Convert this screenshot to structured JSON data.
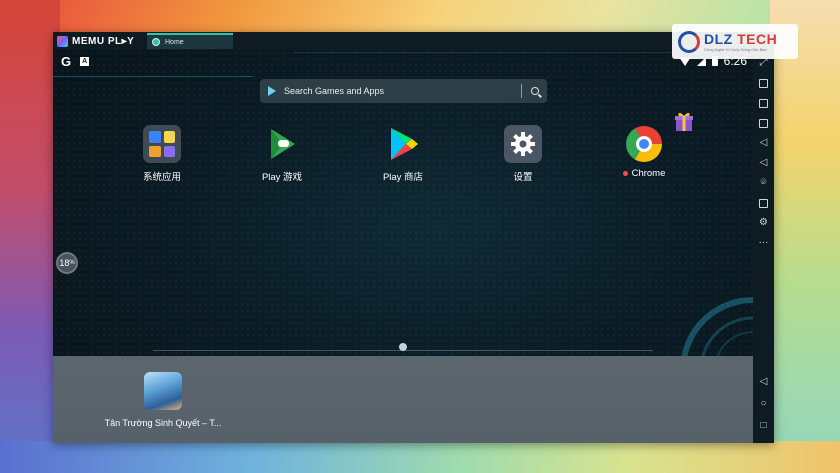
{
  "emulator": {
    "brand": "MEMU PL▸Y",
    "tab_label": "Home"
  },
  "status_bar": {
    "google_letter": "G",
    "a_letter": "A",
    "time": "6:26"
  },
  "search": {
    "placeholder": "Search Games and Apps"
  },
  "apps": [
    {
      "label": "系统应用",
      "icon": "system-apps-folder-icon"
    },
    {
      "label": "Play 游戏",
      "icon": "play-games-icon"
    },
    {
      "label": "Play 商店",
      "icon": "play-store-icon"
    },
    {
      "label": "设置",
      "icon": "settings-gear-icon"
    },
    {
      "label": "Chrome",
      "icon": "chrome-icon",
      "new_badge": true
    }
  ],
  "progress": {
    "value": "18",
    "unit": "%"
  },
  "dock": {
    "apps": [
      {
        "label": "Tân Trường Sinh Quyết – T...",
        "icon": "game-icon"
      }
    ]
  },
  "watermark": {
    "title_left": "DLZ ",
    "title_right": "TECH",
    "subtitle": "Công Nghệ Vì Cuộc Sống Của Bạn"
  },
  "side_toolbar": {
    "icons": [
      "fullscreen-icon",
      "keyboard-icon",
      "screenshot-icon",
      "rotate-icon",
      "volume-up-icon",
      "volume-down-icon",
      "location-icon",
      "folder-icon",
      "settings-icon",
      "more-icon"
    ],
    "more_label": "···"
  },
  "nav": {
    "back": "◁",
    "home": "○",
    "recents": "□"
  },
  "colors": {
    "accent": "#2fc5a5",
    "screen_bg": "#0b1b24",
    "dock_bg": "#5c666d"
  }
}
